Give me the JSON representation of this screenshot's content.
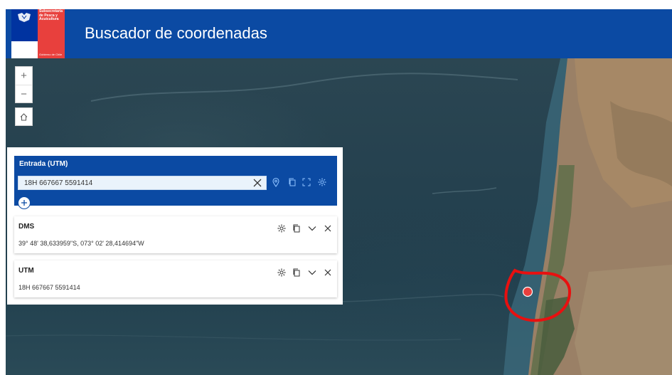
{
  "header": {
    "title": "Buscador de coordenadas",
    "logo_text": "Subsecretaría de Pesca y Acuicultura",
    "logo_subtext": "Gobierno de Chile",
    "color": "#0b4aa3"
  },
  "map_controls": {
    "zoom_in": "+",
    "zoom_out": "−"
  },
  "input_panel": {
    "label": "Entrada (UTM)",
    "value": "18H 667667 5591414"
  },
  "results": [
    {
      "title": "DMS",
      "value": "39° 48' 38,633959\"S, 073° 02' 28,414694\"W"
    },
    {
      "title": "UTM",
      "value": "18H 667667 5591414"
    }
  ]
}
